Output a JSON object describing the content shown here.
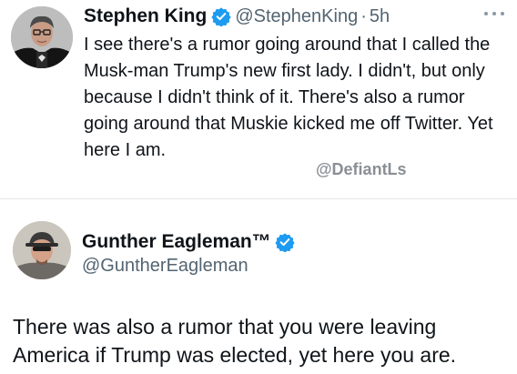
{
  "tweet1": {
    "author_name": "Stephen King",
    "handle": "@StephenKing",
    "separator": "·",
    "time": "5h",
    "verified_icon": "verified-badge-icon",
    "text": "I see there's a rumor going around that I called the Musk-man Trump's new first lady. I didn't, but only because I didn't think of it. There's also a rumor going around that Muskie kicked me off Twitter. Yet here I am."
  },
  "watermark": "@DefiantLs",
  "tweet2": {
    "author_name": "Gunther Eagleman™",
    "handle": "@GuntherEagleman",
    "verified_icon": "verified-badge-icon",
    "text": "There was also a rumor that you were leaving America if Trump was elected, yet here you are."
  },
  "colors": {
    "verified_blue": "#1d9bf0",
    "text_primary": "#0f1419",
    "text_secondary": "#536471",
    "watermark_gray": "#8a8f95"
  }
}
